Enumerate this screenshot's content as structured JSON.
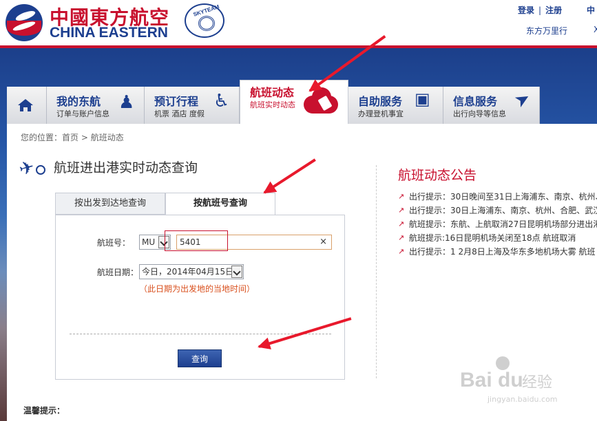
{
  "header": {
    "brand_cn": "中國東方航空",
    "brand_en": "CHINA EASTERN",
    "skyteam": "SKYTEAM",
    "login": "登录",
    "separator": "|",
    "register": "注册",
    "lang": "中",
    "member": "东方万里行",
    "more": "X"
  },
  "nav": {
    "home_icon": "home-icon",
    "tabs": [
      {
        "title": "我的东航",
        "sub": "订单与账户信息",
        "icon": "user-plane-icon"
      },
      {
        "title": "预订行程",
        "sub": "机票 酒店 度假",
        "icon": "traveler-luggage-icon"
      },
      {
        "title": "航班动态",
        "sub": "航班实时动态",
        "icon": "cloud-tag-icon"
      },
      {
        "title": "自助服务",
        "sub": "办理登机事宜",
        "icon": "monitor-plane-icon"
      },
      {
        "title": "信息服务",
        "sub": "出行向导等信息",
        "icon": "arrow-pointer-icon"
      }
    ],
    "active_index": 2
  },
  "breadcrumb": {
    "prefix": "您的位置：",
    "home": "首页",
    "sep": ">",
    "current": "航班动态"
  },
  "page": {
    "title": "航班进出港实时动态查询"
  },
  "search": {
    "tab_route": "按出发到达地查询",
    "tab_flight": "按航班号查询",
    "flight_label": "航班号：",
    "airline_code": "MU",
    "flight_number": "5401",
    "clear": "×",
    "date_label": "航班日期：",
    "date_value": "今日，2014年04月15日",
    "date_hint": "（此日期为出发地的当地时间）",
    "query_button": "查询"
  },
  "notice": {
    "title": "航班动态公告",
    "items": [
      "出行提示：30日晚间至31日上海浦东、南京、杭州、",
      "出行提示：30日上海浦东、南京、杭州、合肥、武汉",
      "航班提示：东航、上航取消27日昆明机场部分进出港",
      "航班提示:16日昆明机场关闭至18点 航班取消",
      "出行提示：1 2月8日上海及华东多地机场大雾 航班"
    ]
  },
  "tips": {
    "label": "温馨提示："
  },
  "watermark": {
    "brand": "Bai du",
    "jingyan": "经验",
    "url": "jingyan.baidu.com"
  },
  "colors": {
    "brand_red": "#c8102e",
    "brand_blue": "#1d3f8f",
    "hint_orange": "#d9501e",
    "annotation_red": "#e8192c"
  }
}
